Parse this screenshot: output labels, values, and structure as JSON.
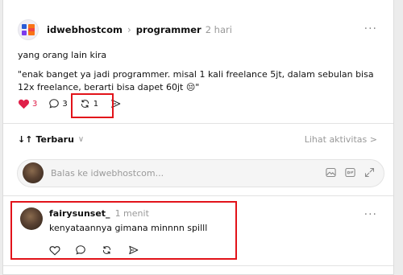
{
  "post": {
    "author": "idwebhostcom",
    "community": "programmer",
    "time": "2 hari",
    "text_line1": "yang orang lain kira",
    "text_main": "\"enak banget ya jadi programmer. misal 1 kali freelance 5jt, dalam sebulan bisa 12x freelance, berarti bisa dapet 60jt 😔\"",
    "likes": "3",
    "comments": "3",
    "reposts": "1",
    "heart_color": "#e0204a"
  },
  "replies_bar": {
    "sort_label": "Terbaru",
    "activity_link": "Lihat aktivitas >"
  },
  "reply_input": {
    "placeholder": "Balas ke idwebhostcom..."
  },
  "comment": {
    "author": "fairysunset_",
    "time": "1 menit",
    "text": "kenyataannya gimana minnnn spilll"
  },
  "highlight_color": "#e2131a"
}
